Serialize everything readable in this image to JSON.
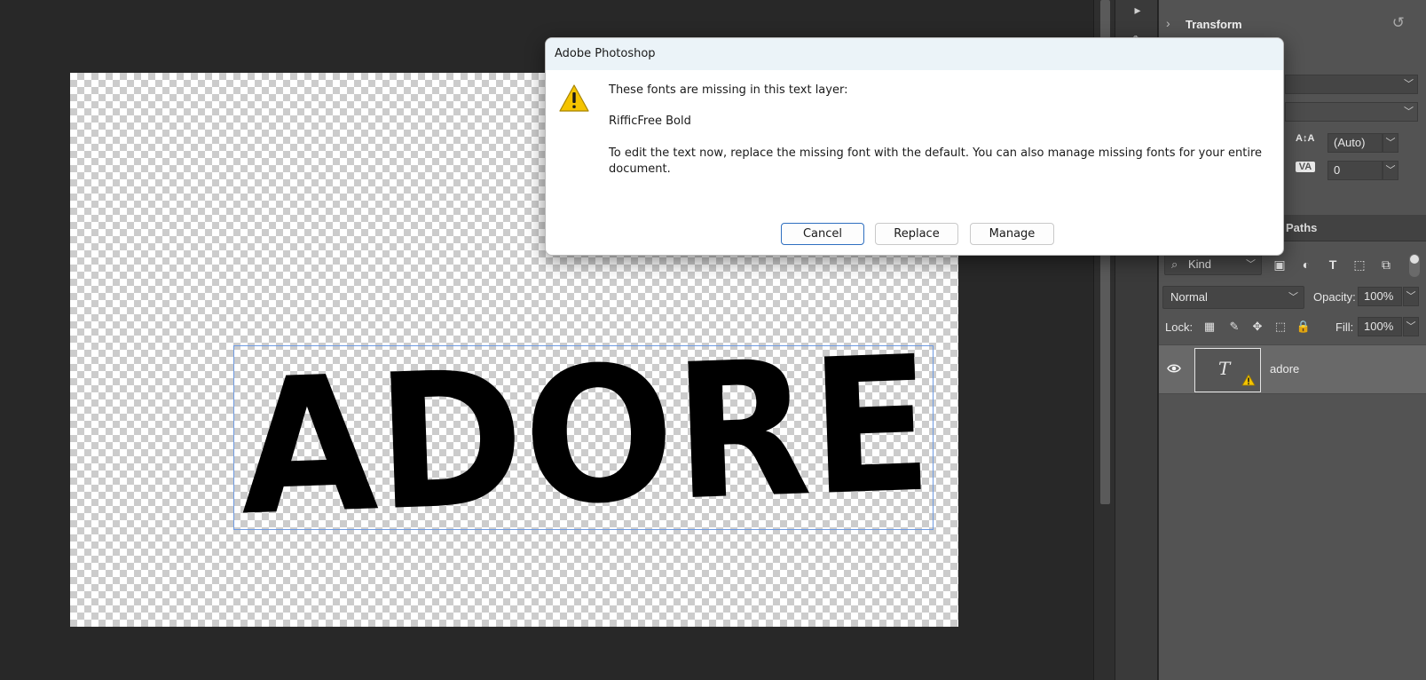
{
  "canvas": {
    "text_layer_content": "ADORE"
  },
  "right_panel": {
    "transform_label": "Transform",
    "leading_value": "(Auto)",
    "tracking_value": "0",
    "tab_paths": "Paths",
    "filter_kind": "Kind",
    "blend_mode": "Normal",
    "opacity_label": "Opacity:",
    "opacity_value": "100%",
    "lock_label": "Lock:",
    "fill_label": "Fill:",
    "fill_value": "100%",
    "layers": [
      {
        "name": "adore",
        "type": "text",
        "visible": true,
        "missing_font_warning": true
      }
    ]
  },
  "dialog": {
    "title": "Adobe Photoshop",
    "message": "These fonts are missing in this text layer:",
    "missing_font": "RifficFree Bold",
    "detail": "To edit the text now, replace the missing font with the default. You can also manage missing fonts for your entire document.",
    "buttons": {
      "cancel": "Cancel",
      "replace": "Replace",
      "manage": "Manage"
    }
  },
  "colors": {
    "app_bg": "#282828",
    "panel_bg": "#535353",
    "selected_layer_bg": "#696969",
    "selection_box": "#6f9be2",
    "dialog_titlebar": "#ebf3f8",
    "primary_button_border": "#2f6fc0",
    "warning_yellow": "#f5c400"
  },
  "icons": [
    "warning-icon",
    "search-icon",
    "image-filter-icon",
    "adjustment-filter-icon",
    "type-filter-icon",
    "shape-filter-icon",
    "smart-object-filter-icon",
    "lock-transparent-icon",
    "lock-paint-icon",
    "lock-position-icon",
    "lock-artboard-icon",
    "lock-all-icon",
    "eye-icon",
    "reset-icon",
    "chevron-right-icon"
  ]
}
